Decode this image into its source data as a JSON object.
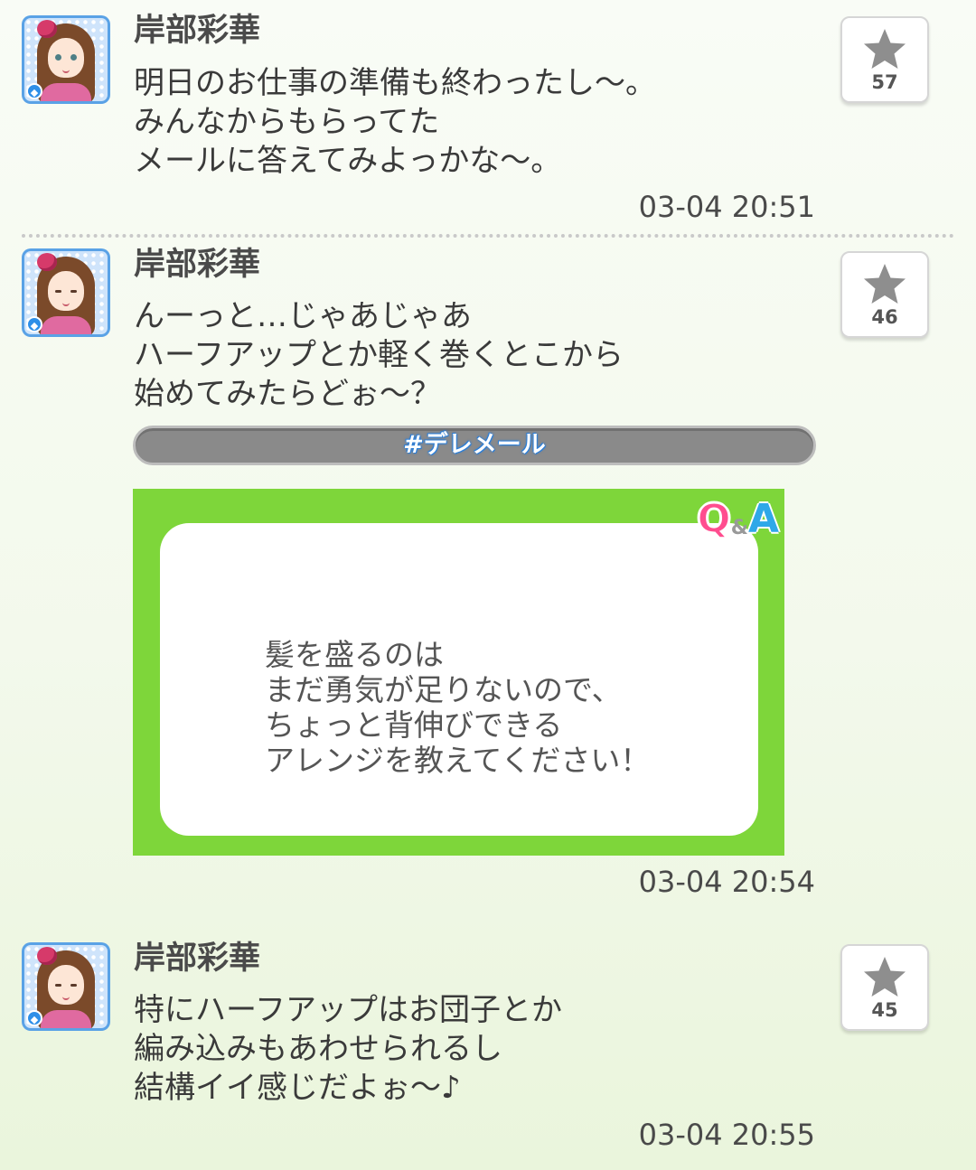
{
  "posts": [
    {
      "author": "岸部彩華",
      "lines": [
        "明日のお仕事の準備も終わったし〜。",
        "みんなからもらってた",
        "メールに答えてみよっかな〜。"
      ],
      "timestamp": "03-04 20:51",
      "favorites": "57"
    },
    {
      "author": "岸部彩華",
      "lines": [
        "んーっと…じゃあじゃあ",
        "ハーフアップとか軽く巻くとこから",
        "始めてみたらどぉ〜？"
      ],
      "hashtag": "#デレメール",
      "attachment": {
        "logo_q": "Q",
        "logo_amp": "&",
        "logo_a": "A",
        "lines": [
          "髪を盛るのは",
          "まだ勇気が足りないので、",
          "ちょっと背伸びできる",
          "アレンジを教えてください！"
        ]
      },
      "timestamp": "03-04 20:54",
      "favorites": "46"
    },
    {
      "author": "岸部彩華",
      "lines": [
        "特にハーフアップはお団子とか",
        "編み込みもあわせられるし",
        "結構イイ感じだよぉ〜♪"
      ],
      "timestamp": "03-04 20:55",
      "favorites": "45"
    }
  ],
  "icons": {
    "favorite": "star-icon",
    "badge": "diamond-icon"
  },
  "colors": {
    "accent_green": "#7ed63a",
    "hashtag_glow": "#2d7ed6",
    "avatar_frame": "#5aa2e6"
  }
}
